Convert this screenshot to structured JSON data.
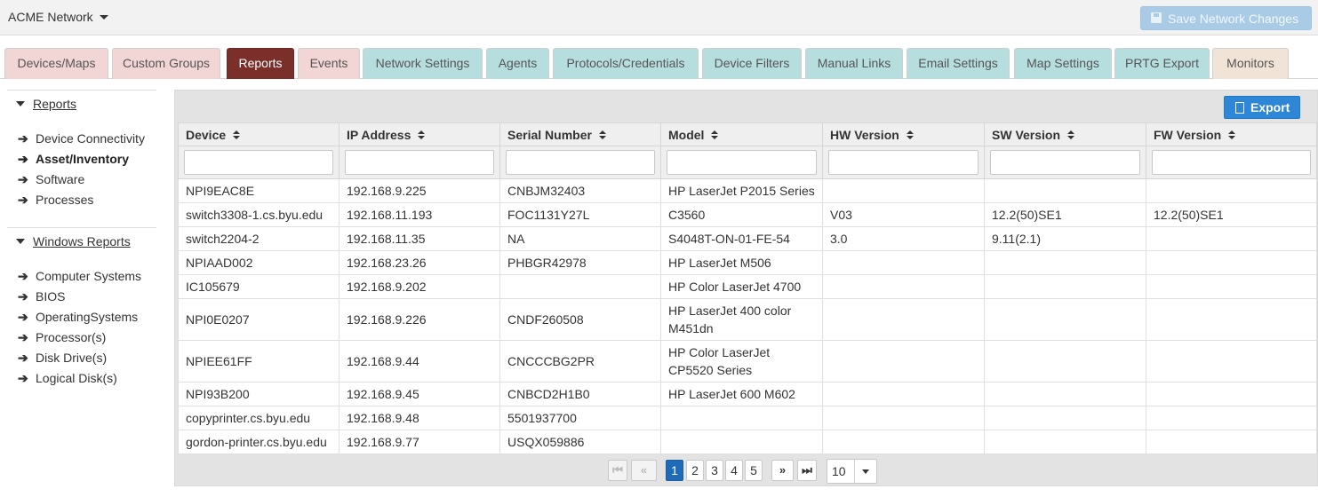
{
  "topbar": {
    "brand": "ACME Network",
    "save_label": "Save Network Changes"
  },
  "tabs": [
    {
      "label": "Devices/Maps",
      "color": "pink"
    },
    {
      "label": "Custom Groups",
      "color": "pink"
    },
    {
      "label": "Reports",
      "color": "active"
    },
    {
      "label": "Events",
      "color": "pink"
    },
    {
      "label": "Network Settings",
      "color": "teal"
    },
    {
      "label": "Agents",
      "color": "teal"
    },
    {
      "label": "Protocols/Credentials",
      "color": "teal"
    },
    {
      "label": "Device Filters",
      "color": "teal"
    },
    {
      "label": "Manual Links",
      "color": "teal"
    },
    {
      "label": "Email Settings",
      "color": "teal"
    },
    {
      "label": "Map Settings",
      "color": "teal"
    },
    {
      "label": "PRTG Export",
      "color": "teal"
    },
    {
      "label": "Monitors",
      "color": "beige"
    }
  ],
  "sidebar": {
    "reports_heading": "Reports",
    "reports_items": [
      {
        "label": "Device Connectivity",
        "selected": false
      },
      {
        "label": "Asset/Inventory",
        "selected": true
      },
      {
        "label": "Software",
        "selected": false
      },
      {
        "label": "Processes",
        "selected": false
      }
    ],
    "windows_heading": "Windows Reports",
    "windows_items": [
      {
        "label": "Computer Systems"
      },
      {
        "label": "BIOS"
      },
      {
        "label": "OperatingSystems"
      },
      {
        "label": "Processor(s)"
      },
      {
        "label": "Disk Drive(s)"
      },
      {
        "label": "Logical Disk(s)"
      }
    ]
  },
  "export_label": "Export",
  "table": {
    "columns": [
      "Device",
      "IP Address",
      "Serial Number",
      "Model",
      "HW Version",
      "SW Version",
      "FW Version"
    ],
    "rows": [
      [
        "NPI9EAC8E",
        "192.168.9.225",
        "CNBJM32403",
        "HP LaserJet P2015 Series",
        "",
        "",
        ""
      ],
      [
        "switch3308-1.cs.byu.edu",
        "192.168.11.193",
        "FOC1131Y27L",
        "C3560",
        "V03",
        "12.2(50)SE1",
        "12.2(50)SE1"
      ],
      [
        "switch2204-2",
        "192.168.11.35",
        "NA",
        "S4048T-ON-01-FE-54",
        "3.0",
        "9.11(2.1)",
        ""
      ],
      [
        "NPIAAD002",
        "192.168.23.26",
        "PHBGR42978",
        "HP LaserJet M506",
        "",
        "",
        ""
      ],
      [
        "IC105679",
        "192.168.9.202",
        "",
        "HP Color LaserJet 4700",
        "",
        "",
        ""
      ],
      [
        "NPI0E0207",
        "192.168.9.226",
        "CNDF260508",
        "HP LaserJet 400 color M451dn",
        "",
        "",
        ""
      ],
      [
        "NPIEE61FF",
        "192.168.9.44",
        "CNCCCBG2PR",
        "HP Color LaserJet CP5520 Series",
        "",
        "",
        ""
      ],
      [
        "NPI93B200",
        "192.168.9.45",
        "CNBCD2H1B0",
        "HP LaserJet 600 M602",
        "",
        "",
        ""
      ],
      [
        "copyprinter.cs.byu.edu",
        "192.168.9.48",
        "5501937700",
        "",
        "",
        "",
        ""
      ],
      [
        "gordon-printer.cs.byu.edu",
        "192.168.9.77",
        "USQX059886",
        "",
        "",
        "",
        ""
      ]
    ]
  },
  "pager": {
    "pages": [
      "1",
      "2",
      "3",
      "4",
      "5"
    ],
    "current_page": "1",
    "page_size": "10"
  },
  "colors": {
    "active_tab": "#7b2f2a",
    "pink_tab": "#f2d5d5",
    "teal_tab": "#b6dede",
    "beige_tab": "#f1e3d6",
    "export_blue": "#2d87d6",
    "current_page_blue": "#1f6bb7"
  }
}
